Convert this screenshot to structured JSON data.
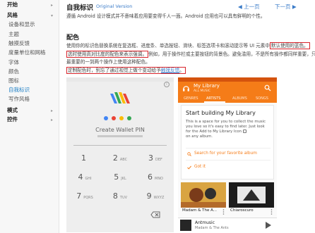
{
  "sidebar": {
    "items": [
      {
        "label": "开始",
        "head": true,
        "arrow": "▸"
      },
      {
        "label": "风格",
        "head": true,
        "arrow": "▾"
      },
      {
        "label": "设备和显示"
      },
      {
        "label": "主题"
      },
      {
        "label": "触摸反馈"
      },
      {
        "label": "度量单位和网格"
      },
      {
        "label": "字体"
      },
      {
        "label": "颜色"
      },
      {
        "label": "图标"
      },
      {
        "label": "自我标识",
        "active": true
      },
      {
        "label": "写作风格"
      },
      {
        "label": "模式",
        "head": true,
        "arrow": "▸"
      },
      {
        "label": "控件",
        "head": true,
        "arrow": "▸"
      }
    ]
  },
  "header": {
    "title": "自我标识",
    "version": "Original Version",
    "prev": "上一页",
    "next": "下一页"
  },
  "intro": "遵循 Android 设计模式并不意味着应用要变得千人一面。Android 应用也可以具有鲜明的个性。",
  "section_title": "配色",
  "para1": {
    "a": "使用你的标识色替换系统在复选框、进度条、单选按钮、滑块、标签选项卡和滚动提示等 UI 元素中",
    "b": "默认使用的蓝色。",
    "c": "选时使用高对比度的配色来表示强调。",
    "d": "例如，用于操作栏或主要按钮的背景色。避免滥用，不是所有操作都同样重要，只在",
    "e": "最重要的一到两个操作上使用这种配色。"
  },
  "para2": {
    "a": "定制配色时，别忘了通过视觉上做个变动给予",
    "link": "触摸反馈",
    "b": "。"
  },
  "wallet": {
    "prompt": "Create Wallet PIN",
    "info_icon": "info-icon",
    "dot_colors": [
      "#4285f4",
      "#ea4335",
      "#fbbc05",
      "#34a853"
    ],
    "keys": [
      {
        "d": "1",
        "l": ""
      },
      {
        "d": "2",
        "l": "ABC"
      },
      {
        "d": "3",
        "l": "DEF"
      },
      {
        "d": "4",
        "l": "GHI"
      },
      {
        "d": "5",
        "l": "JKL"
      },
      {
        "d": "6",
        "l": "MNO"
      },
      {
        "d": "7",
        "l": "PQRS"
      },
      {
        "d": "8",
        "l": "TUV"
      },
      {
        "d": "9",
        "l": "WXYZ"
      }
    ]
  },
  "music": {
    "title": "My Library",
    "subtitle": "ALL MUSIC",
    "accent": "#f57c18",
    "tabs": [
      "GENRES",
      "ARTISTS",
      "ALBUMS",
      "SONGS"
    ],
    "active_tab": "ARTISTS",
    "card_title": "Start building My Library",
    "card_body": [
      "This is a space for you to collect the music",
      "you love so it's easy to find later. Just look",
      "for the Add to My Library Icon"
    ],
    "card_body_tail": "on any album.",
    "search_action": "Search for your favorite album",
    "confirm_action": "Got it",
    "tiles": [
      {
        "label": "Madam & The A..."
      },
      {
        "label": "Chiaroscuro"
      }
    ],
    "now_playing": {
      "title": "Antmusic",
      "artist": "Madam & The Ants"
    }
  }
}
